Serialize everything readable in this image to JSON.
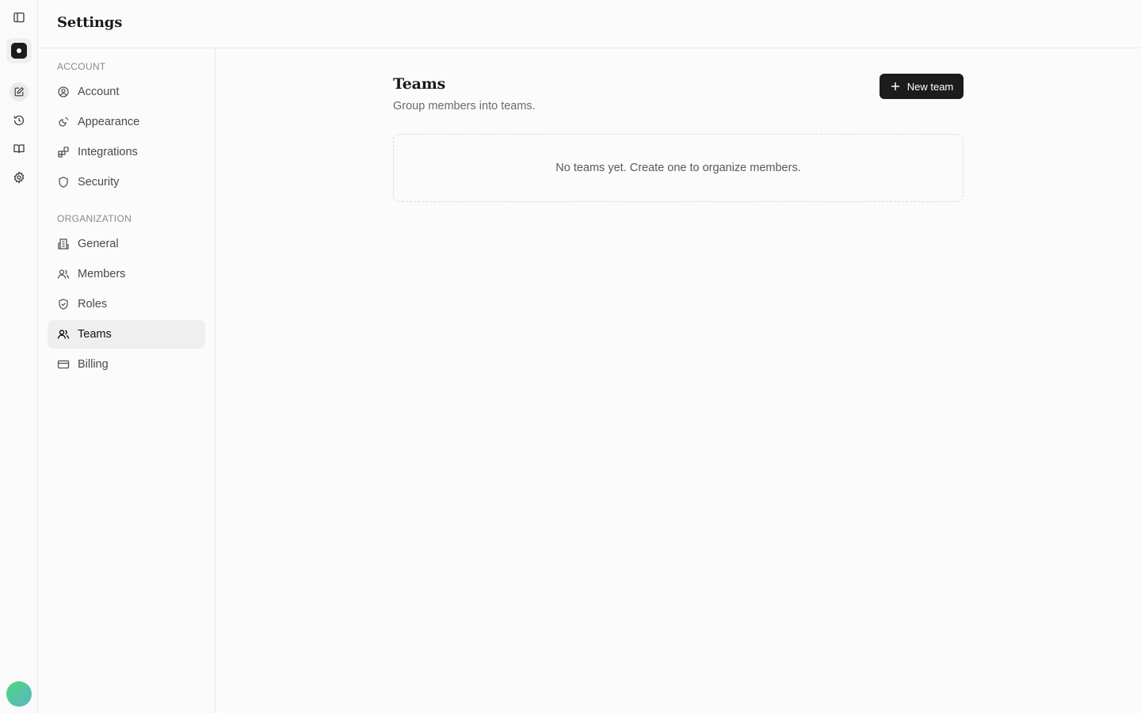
{
  "rail": {
    "items": [
      {
        "icon": "sidebar-toggle-icon"
      },
      {
        "icon": "app-logo"
      },
      {
        "icon": "edit-icon"
      },
      {
        "icon": "history-icon"
      },
      {
        "icon": "book-icon"
      },
      {
        "icon": "gear-icon"
      }
    ],
    "avatar_colors": [
      "#4fd67c",
      "#5ab5c8"
    ]
  },
  "header": {
    "title": "Settings"
  },
  "sidebar": {
    "sections": [
      {
        "label": "ACCOUNT",
        "items": [
          {
            "label": "Account",
            "icon": "user-circle-icon"
          },
          {
            "label": "Appearance",
            "icon": "sun-moon-icon"
          },
          {
            "label": "Integrations",
            "icon": "blocks-icon"
          },
          {
            "label": "Security",
            "icon": "shield-icon"
          }
        ]
      },
      {
        "label": "ORGANIZATION",
        "items": [
          {
            "label": "General",
            "icon": "building-icon"
          },
          {
            "label": "Members",
            "icon": "users-icon"
          },
          {
            "label": "Roles",
            "icon": "shield-check-icon"
          },
          {
            "label": "Teams",
            "icon": "users-icon",
            "active": true
          },
          {
            "label": "Billing",
            "icon": "credit-card-icon"
          }
        ]
      }
    ]
  },
  "main": {
    "title": "Teams",
    "description": "Group members into teams.",
    "new_button_label": "New team",
    "empty_state": "No teams yet. Create one to organize members."
  },
  "colors": {
    "primary_button": "#1c1c1c",
    "active_nav_bg": "#efefef",
    "border": "#e8e8e8"
  }
}
